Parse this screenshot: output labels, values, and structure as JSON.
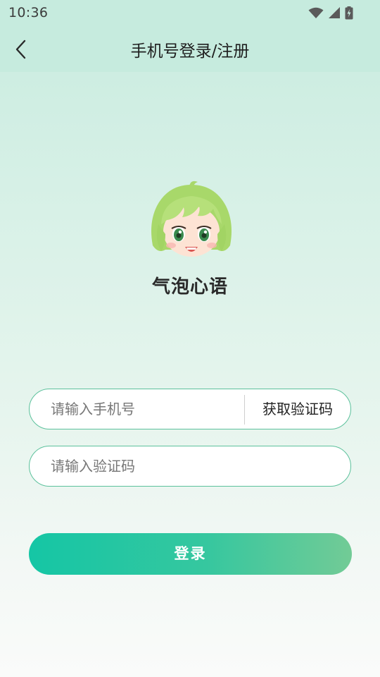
{
  "status_bar": {
    "time": "10:36"
  },
  "nav": {
    "title": "手机号登录/注册"
  },
  "app": {
    "name": "气泡心语"
  },
  "phone_field": {
    "placeholder": "请输入手机号",
    "value": "",
    "get_code_label": "获取验证码"
  },
  "code_field": {
    "placeholder": "请输入验证码",
    "value": ""
  },
  "login_button": {
    "label": "登录"
  },
  "colors": {
    "accent": "#15c6a5",
    "accent_end": "#72cb96",
    "field_border": "#5cc19c",
    "header_bg": "#c6ebde"
  },
  "icons": {
    "back": "chevron-left-icon",
    "wifi": "wifi-icon",
    "signal": "signal-icon",
    "battery": "battery-icon"
  }
}
